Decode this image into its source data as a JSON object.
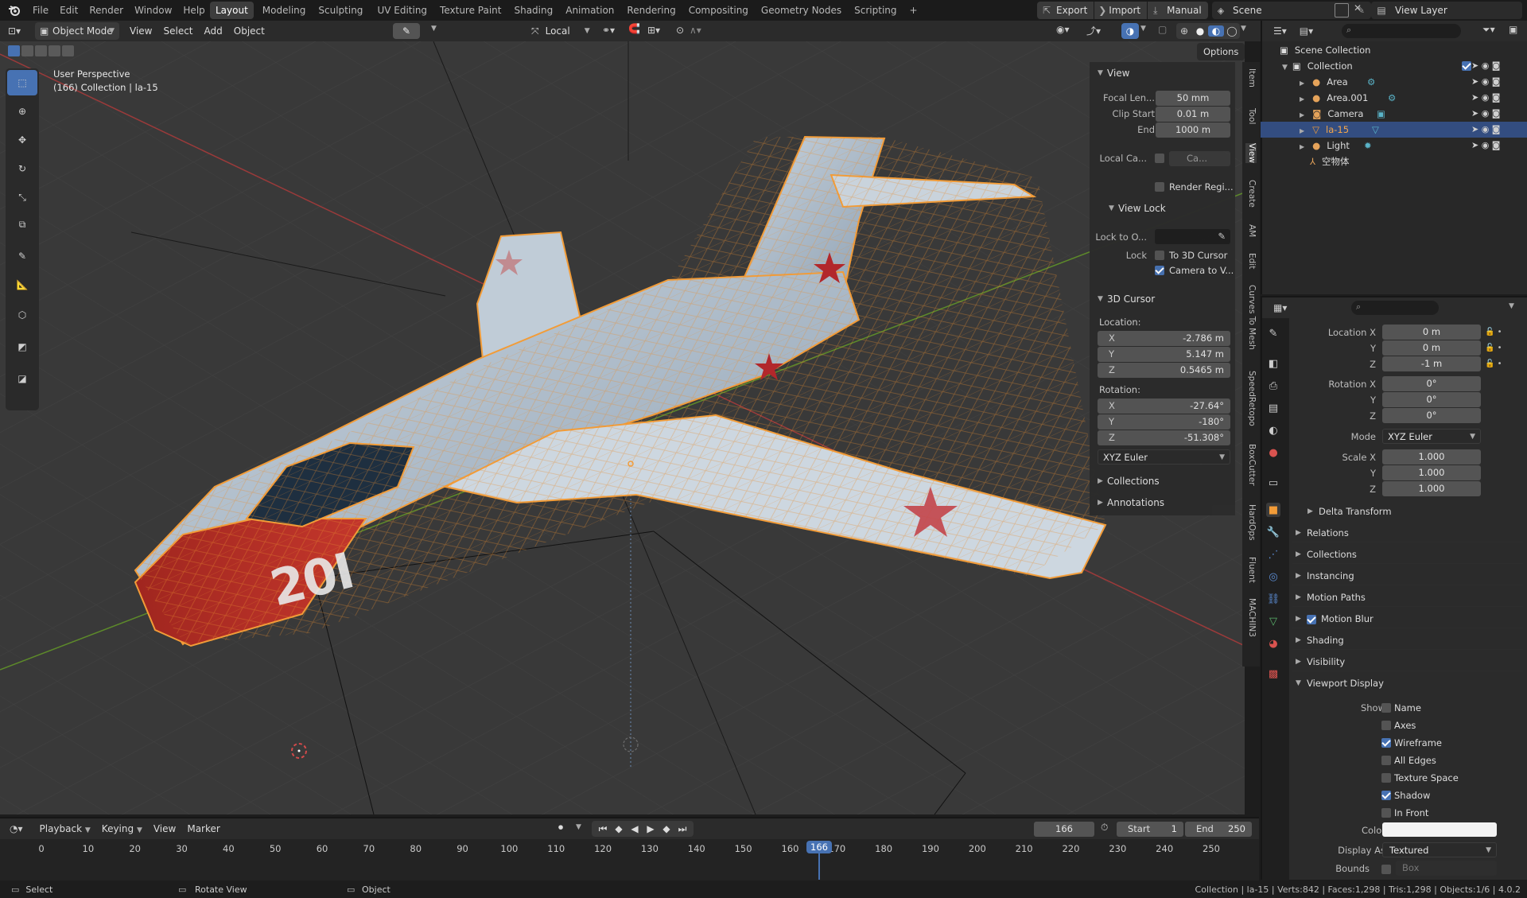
{
  "top_menu": {
    "file": "File",
    "edit": "Edit",
    "render": "Render",
    "window": "Window",
    "help": "Help"
  },
  "workspaces": [
    {
      "label": "Layout",
      "active": true
    },
    {
      "label": "Modeling"
    },
    {
      "label": "Sculpting"
    },
    {
      "label": "UV Editing"
    },
    {
      "label": "Texture Paint"
    },
    {
      "label": "Shading"
    },
    {
      "label": "Animation"
    },
    {
      "label": "Rendering"
    },
    {
      "label": "Compositing"
    },
    {
      "label": "Geometry Nodes"
    },
    {
      "label": "Scripting"
    }
  ],
  "add_workspace": "+",
  "top_right": {
    "export": "Export",
    "import": "Import",
    "manual": "Manual",
    "scene": "Scene",
    "view_layer": "View Layer"
  },
  "viewport_header": {
    "mode": "Object Mode",
    "view": "View",
    "select": "Select",
    "add": "Add",
    "object": "Object",
    "transform_orientation": "Local",
    "options": "Options"
  },
  "viewport_overlay": {
    "perspective": "User Perspective",
    "collection_line": "(166) Collection | la-15"
  },
  "npanel": {
    "view_header": "View",
    "focal_label": "Focal Len...",
    "focal_value": "50 mm",
    "clip_start_label": "Clip Start",
    "clip_start_value": "0.01 m",
    "end_label": "End",
    "end_value": "1000 m",
    "local_camera_label": "Local Ca...",
    "local_camera_value": "Ca...",
    "render_region": "Render Regi...",
    "view_lock_header": "View Lock",
    "lock_to_label": "Lock to O...",
    "lock_label": "Lock",
    "to_3d_cursor": "To 3D Cursor",
    "camera_to_view": "Camera to V...",
    "cursor_header": "3D Cursor",
    "location_label": "Location:",
    "loc_x": "-2.786 m",
    "loc_y": "5.147 m",
    "loc_z": "0.5465 m",
    "rotation_label": "Rotation:",
    "rot_x": "-27.64°",
    "rot_y": "-180°",
    "rot_z": "-51.308°",
    "rotation_mode": "XYZ Euler",
    "collections": "Collections",
    "annotations": "Annotations",
    "axis_x": "X",
    "axis_y": "Y",
    "axis_z": "Z"
  },
  "vertical_tabs": [
    "Item",
    "Tool",
    "View",
    "Create",
    "AM",
    "Edit",
    "Curves To Mesh",
    "SpeedRetopo",
    "BoxCutter",
    "HardOps",
    "Fluent",
    "MACHIN3"
  ],
  "outliner": {
    "scene_collection": "Scene Collection",
    "collection": "Collection",
    "items": [
      "Area",
      "Area.001",
      "Camera",
      "la-15",
      "Light",
      "空物体"
    ]
  },
  "properties": {
    "location_x_label": "Location X",
    "loc_x": "0 m",
    "loc_y": "0 m",
    "loc_z": "-1 m",
    "rotation_x_label": "Rotation X",
    "rot_x": "0°",
    "rot_y": "0°",
    "rot_z": "0°",
    "mode_label": "Mode",
    "mode_value": "XYZ Euler",
    "scale_x_label": "Scale X",
    "scale_x": "1.000",
    "scale_y": "1.000",
    "scale_z": "1.000",
    "y_label": "Y",
    "z_label": "Z",
    "delta_transform": "Delta Transform",
    "relations": "Relations",
    "collections": "Collections",
    "instancing": "Instancing",
    "motion_paths": "Motion Paths",
    "motion_blur": "Motion Blur",
    "shading": "Shading",
    "visibility": "Visibility",
    "viewport_display": "Viewport Display",
    "show_label": "Show",
    "name": "Name",
    "axes": "Axes",
    "wireframe": "Wireframe",
    "all_edges": "All Edges",
    "texture_space": "Texture Space",
    "shadow": "Shadow",
    "in_front": "In Front",
    "color_label": "Color",
    "display_as_label": "Display As",
    "display_as_value": "Textured",
    "bounds_label": "Bounds",
    "bounds_value": "Box"
  },
  "timeline": {
    "playback": "Playback",
    "keying": "Keying",
    "view": "View",
    "marker": "Marker",
    "current_frame": "166",
    "start_label": "Start",
    "start_value": "1",
    "end_label": "End",
    "end_value": "250",
    "ticks": [
      "0",
      "10",
      "20",
      "30",
      "40",
      "50",
      "60",
      "70",
      "80",
      "90",
      "100",
      "110",
      "120",
      "130",
      "140",
      "150",
      "160",
      "166",
      "170",
      "180",
      "190",
      "200",
      "210",
      "220",
      "230",
      "240",
      "250"
    ]
  },
  "statusbar": {
    "select": "Select",
    "rotate_view": "Rotate View",
    "object": "Object",
    "stats": "Collection | la-15 | Verts:842 | Faces:1,298 | Tris:1,298 | Objects:1/6 | 4.0.2"
  },
  "viewport_text": {
    "nose_number": "20I"
  },
  "colors": {
    "accent": "#4772b3",
    "selection_outline": "#f29c38",
    "nose_red": "#b32a22"
  }
}
